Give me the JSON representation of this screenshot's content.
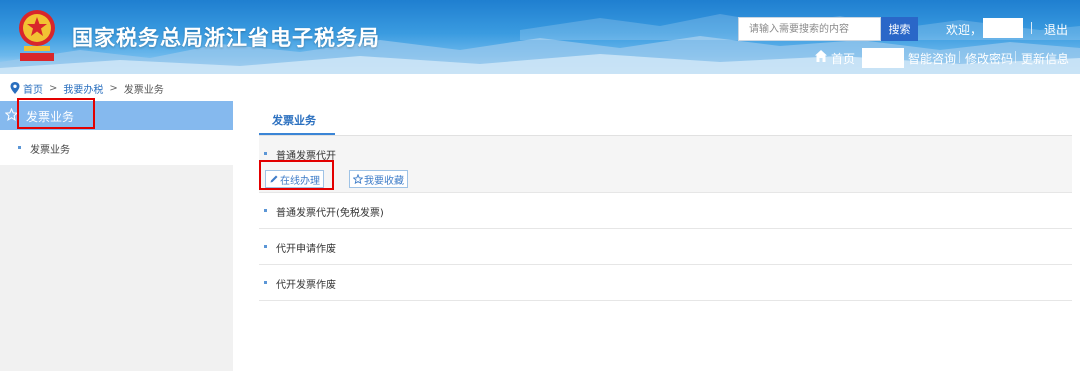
{
  "header": {
    "site_title": "国家税务总局浙江省电子税务局",
    "search_placeholder": "请输入需要搜索的内容",
    "search_button": "搜索",
    "welcome": "欢迎，",
    "logout": "退出",
    "nav": {
      "home": "首页",
      "smart_consult": "智能咨询",
      "change_password": "修改密码",
      "update_info": "更新信息"
    }
  },
  "breadcrumb": [
    "首页",
    "我要办税",
    "发票业务"
  ],
  "sidebar": {
    "header": "发票业务",
    "items": [
      {
        "label": "发票业务"
      }
    ]
  },
  "main": {
    "tab": "发票业务",
    "services": [
      {
        "label": "普通发票代开",
        "actions": [
          "在线办理",
          "我要收藏"
        ]
      },
      {
        "label": "普通发票代开(免税发票)"
      },
      {
        "label": "代开申请作废"
      },
      {
        "label": "代开发票作废"
      }
    ]
  },
  "colors": {
    "accent": "#3b85d6",
    "sidebar_header": "#85b9ee",
    "highlight_box": "#e30000"
  }
}
